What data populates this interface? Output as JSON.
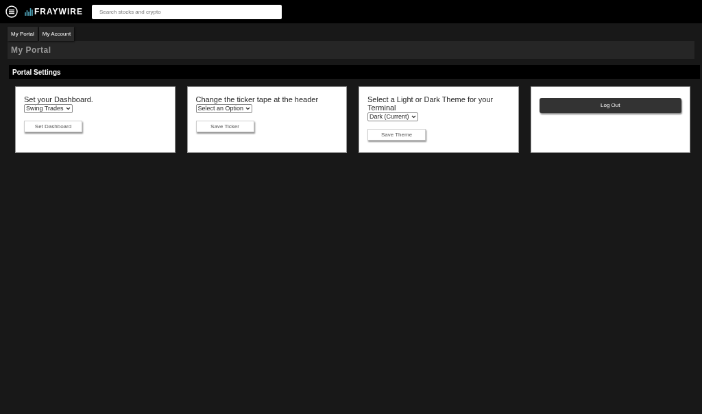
{
  "header": {
    "logo": "FRAYWIRE",
    "search": {
      "placeholder": "Search stocks and crypto"
    }
  },
  "tabs": [
    "My Portal",
    "My Account"
  ],
  "page_title": "My Portal",
  "section_title": "Portal Settings",
  "cards": [
    {
      "kind": "setting",
      "label": "Set your Dashboard.",
      "select": "Swing Trades",
      "button": "Set Dashboard"
    },
    {
      "kind": "setting",
      "label": "Change the ticker tape at the header",
      "select": "Select an Option",
      "button": "Save Ticker"
    },
    {
      "kind": "setting",
      "label": "Select a Light or Dark Theme for your Terminal",
      "select": "Dark (Current)",
      "button": "Save Theme"
    },
    {
      "kind": "logout",
      "button": "Log Out"
    }
  ]
}
